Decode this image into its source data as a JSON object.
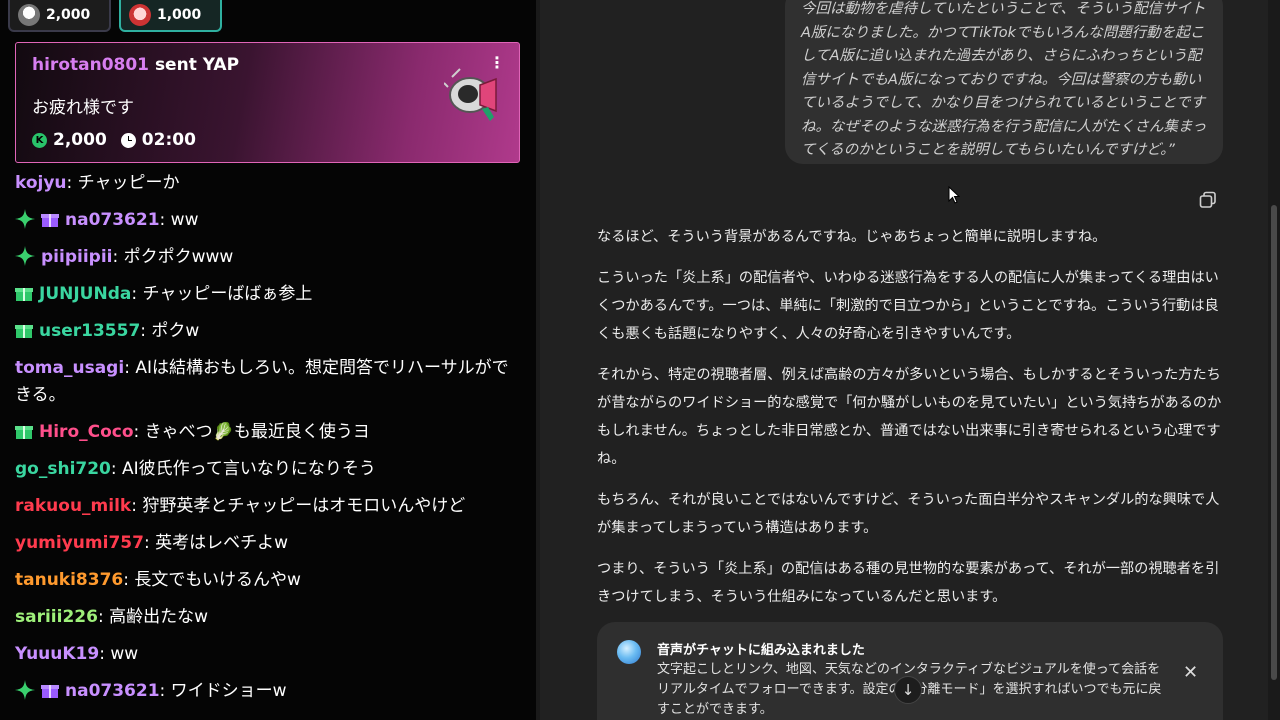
{
  "stream_chat": {
    "gift_pills": [
      {
        "amount": "2,000"
      },
      {
        "amount": "1,000"
      }
    ],
    "gift_card": {
      "user": "hirotan0801",
      "sent_text": "sent YAP",
      "message": "お疲れ様です",
      "coins": "2,000",
      "timer": "02:00",
      "menu_icon": "kebab-icon",
      "gift_icon": "megaphone-icon"
    },
    "messages": [
      {
        "badges": [],
        "user": "kojyu",
        "user_color": "#c890ff",
        "text": ": チャッピーか"
      },
      {
        "badges": [
          "spark",
          "gift-purple"
        ],
        "user": "na073621",
        "user_color": "#c890ff",
        "text": ": ww"
      },
      {
        "badges": [
          "spark"
        ],
        "user": "piipiipii",
        "user_color": "#c890ff",
        "text": ": ポクポクwww"
      },
      {
        "badges": [
          "gift-green"
        ],
        "user": "JUNJUNda",
        "user_color": "#3ad6a0",
        "text": ": チャッピーばばぁ参上"
      },
      {
        "badges": [
          "gift-green"
        ],
        "user": "user13557",
        "user_color": "#3ad6a0",
        "text": ": ポクw"
      },
      {
        "badges": [],
        "user": "toma_usagi",
        "user_color": "#c890ff",
        "text": ": AIは結構おもしろい。想定問答でリハーサルができる。"
      },
      {
        "badges": [
          "gift-green"
        ],
        "user": "Hiro_Coco",
        "user_color": "#ff4f8b",
        "text": ": きゃべつ🥬も最近良く使うヨ"
      },
      {
        "badges": [],
        "user": "go_shi720",
        "user_color": "#3ad6a0",
        "text": ": AI彼氏作って言いなりになりそう"
      },
      {
        "badges": [],
        "user": "rakuou_milk",
        "user_color": "#ff3b4e",
        "text": ": 狩野英孝とチャッピーはオモロいんやけど"
      },
      {
        "badges": [],
        "user": "yumiyumi757",
        "user_color": "#ff3b4e",
        "text": ": 英考はレベチよw"
      },
      {
        "badges": [],
        "user": "tanuki8376",
        "user_color": "#ff9a2e",
        "text": ": 長文でもいけるんやw"
      },
      {
        "badges": [],
        "user": "sariii226",
        "user_color": "#9ef07a",
        "text": ": 高齢出たなw"
      },
      {
        "badges": [],
        "user": "YuuuK19",
        "user_color": "#c890ff",
        "text": ": ww"
      },
      {
        "badges": [
          "spark",
          "gift-purple"
        ],
        "user": "na073621",
        "user_color": "#c890ff",
        "text": ": ワイドショーw"
      }
    ]
  },
  "ai_chat": {
    "user_message": "今回は動物を虐待していたということで、そういう配信サイトA版になりました。かつてTikTokでもいろんな問題行動を起こしてA版に追い込まれた過去があり、さらにふわっちという配信サイトでもA版になっておりですね。今回は警察の方も動いているようでして、かなり目をつけられているということですね。なぜそのような迷惑行為を行う配信に人がたくさん集まってくるのかということを説明してもらいたいんですけど。”",
    "copy_icon": "copy-icon",
    "answer_paragraphs": [
      "なるほど、そういう背景があるんですね。じゃあちょっと簡単に説明しますね。",
      "こういった「炎上系」の配信者や、いわゆる迷惑行為をする人の配信に人が集まってくる理由はいくつかあるんです。一つは、単純に「刺激的で目立つから」ということですね。こういう行動は良くも悪くも話題になりやすく、人々の好奇心を引きやすいんです。",
      "それから、特定の視聴者層、例えば高齢の方々が多いという場合、もしかするとそういった方たちが昔ながらのワイドショー的な感覚で「何か騒がしいものを見ていたい」という気持ちがあるのかもしれません。ちょっとした非日常感とか、普通ではない出来事に引き寄せられるという心理ですね。",
      "もちろん、それが良いことではないんですけど、そういった面白半分やスキャンダル的な興味で人が集まってしまうっていう構造はあります。",
      "つまり、そういう「炎上系」の配信はある種の見世物的な要素があって、それが一部の視聴者を引きつけてしまう、そういう仕組みになっているんだと思います。"
    ],
    "notice": {
      "title": "音声がチャットに組み込まれました",
      "body": "文字起こしとリンク、地図、天気などのインタラクティブなビジュアルを使って会話をリアルタイムでフォローできます。設定の「分離モード」を選択すればいつでも元に戻すことができます。",
      "close_icon": "close-icon",
      "scroll_icon": "arrow-down-icon"
    }
  }
}
